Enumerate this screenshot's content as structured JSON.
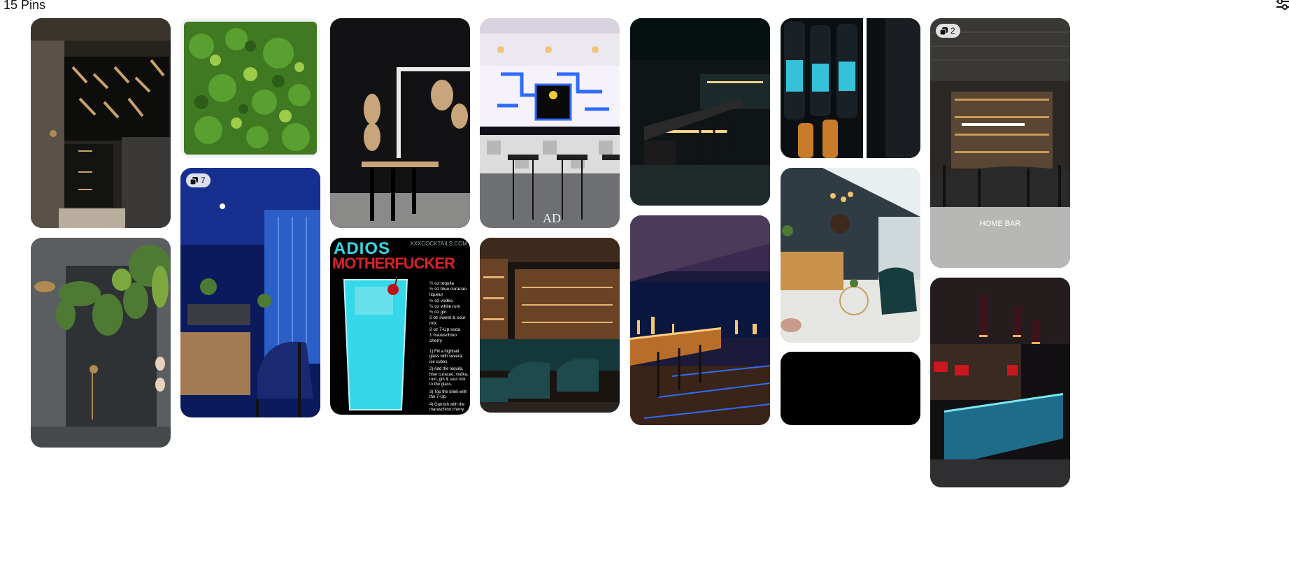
{
  "header": {
    "pin_count": "15 Pins",
    "filter_icon": "filter-sliders-icon"
  },
  "pins": [
    {
      "id": "wine-storage",
      "icon": null
    },
    {
      "id": "green-wall"
    },
    {
      "id": "dark-bar-lamps"
    },
    {
      "id": "arcade-bar",
      "watermark": "AD"
    },
    {
      "id": "led-bar-night"
    },
    {
      "id": "bottles-fridge"
    },
    {
      "id": "home-bar-warehouse",
      "badge": "2",
      "overlay": "HOME BAR"
    },
    {
      "id": "shower-plants"
    },
    {
      "id": "blue-restaurant",
      "badge": "7"
    },
    {
      "id": "cocktail-recipe",
      "recipe": {
        "title_line1": "ADIOS",
        "title_line2": "MOTHERFUCKER",
        "site": "XXXCOCKTAILS.COM",
        "ingredients": [
          "½ oz tequila",
          "½ oz blue curacao liqueur",
          "½ oz vodka",
          "½ oz white rum",
          "½ oz gin",
          "2 oz sweet & sour mix",
          "2 oz 7-Up soda",
          "1 maraschino cherry"
        ],
        "steps": [
          "1) Fill a highball glass with several ice cubes.",
          "2) Add the tequila, blue curacao, vodka, rum, gin & sour mix to the glass.",
          "3) Top the drink with the 7-Up.",
          "4) Garnish with the maraschino cherry."
        ]
      }
    },
    {
      "id": "shelved-bar-stools"
    },
    {
      "id": "rooftop-bar-night"
    },
    {
      "id": "conservatory-lounge"
    },
    {
      "id": "black-pin"
    },
    {
      "id": "blue-lit-bar"
    }
  ],
  "colors": {
    "badge_bg": "#ffffff",
    "recipe_blue": "#35d8e8",
    "recipe_red": "#d8222a"
  }
}
